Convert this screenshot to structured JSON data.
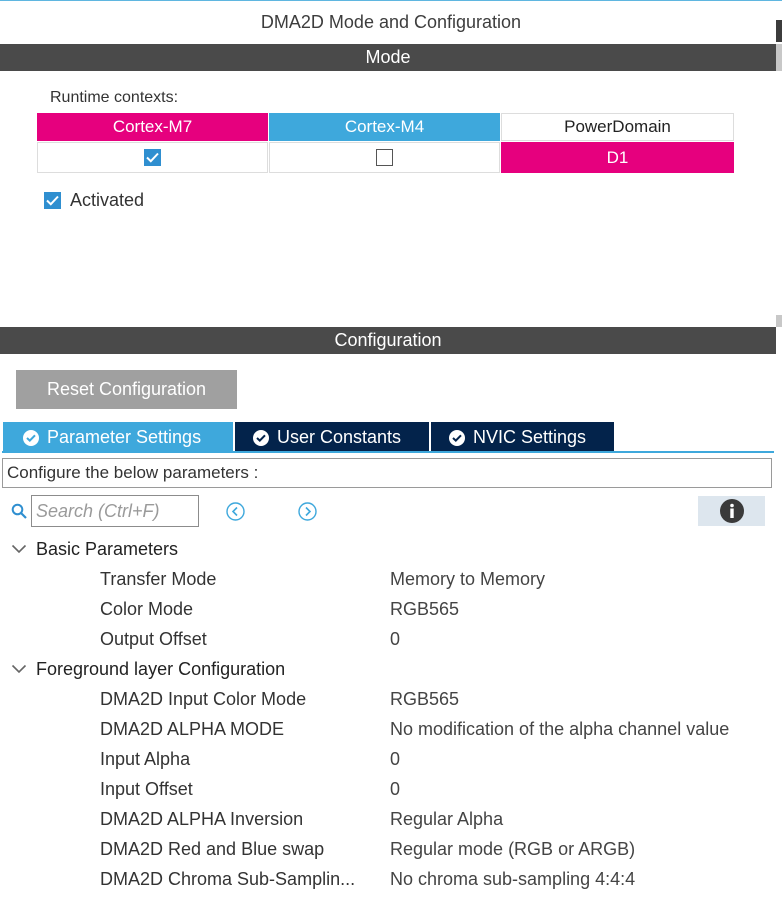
{
  "window": {
    "title": "DMA2D Mode and Configuration"
  },
  "mode": {
    "header": "Mode",
    "runtime_label": "Runtime contexts:",
    "contexts": [
      {
        "label": "Cortex-M7",
        "checked": true,
        "color": "#e6007e"
      },
      {
        "label": "Cortex-M4",
        "checked": false,
        "color": "#3ea8dc"
      }
    ],
    "power_domain": {
      "label": "PowerDomain",
      "value": "D1",
      "color": "#e6007e"
    },
    "activated": {
      "label": "Activated",
      "checked": true
    }
  },
  "configuration": {
    "header": "Configuration",
    "reset_label": "Reset Configuration",
    "tabs": [
      {
        "label": "Parameter Settings",
        "active": true,
        "icon": "check-circle-icon"
      },
      {
        "label": "User Constants",
        "active": false,
        "icon": "check-circle-icon"
      },
      {
        "label": "NVIC Settings",
        "active": false,
        "icon": "check-circle-icon"
      }
    ],
    "prompt": "Configure the below parameters :",
    "search_placeholder": "Search (Ctrl+F)",
    "groups": [
      {
        "name": "Basic Parameters",
        "expanded": true,
        "params": [
          {
            "name": "Transfer Mode",
            "value": "Memory to Memory"
          },
          {
            "name": "Color Mode",
            "value": "RGB565"
          },
          {
            "name": "Output Offset",
            "value": "0"
          }
        ]
      },
      {
        "name": "Foreground layer Configuration",
        "expanded": true,
        "params": [
          {
            "name": "DMA2D Input Color Mode",
            "value": "RGB565"
          },
          {
            "name": "DMA2D ALPHA MODE",
            "value": "No modification of the alpha channel value"
          },
          {
            "name": "Input Alpha",
            "value": "0"
          },
          {
            "name": "Input Offset",
            "value": "0"
          },
          {
            "name": "DMA2D ALPHA Inversion",
            "value": "Regular Alpha"
          },
          {
            "name": "DMA2D Red and Blue swap",
            "value": "Regular mode (RGB or ARGB)"
          },
          {
            "name": "DMA2D Chroma Sub-Samplin...",
            "value": "No chroma sub-sampling 4:4:4"
          }
        ]
      }
    ]
  }
}
